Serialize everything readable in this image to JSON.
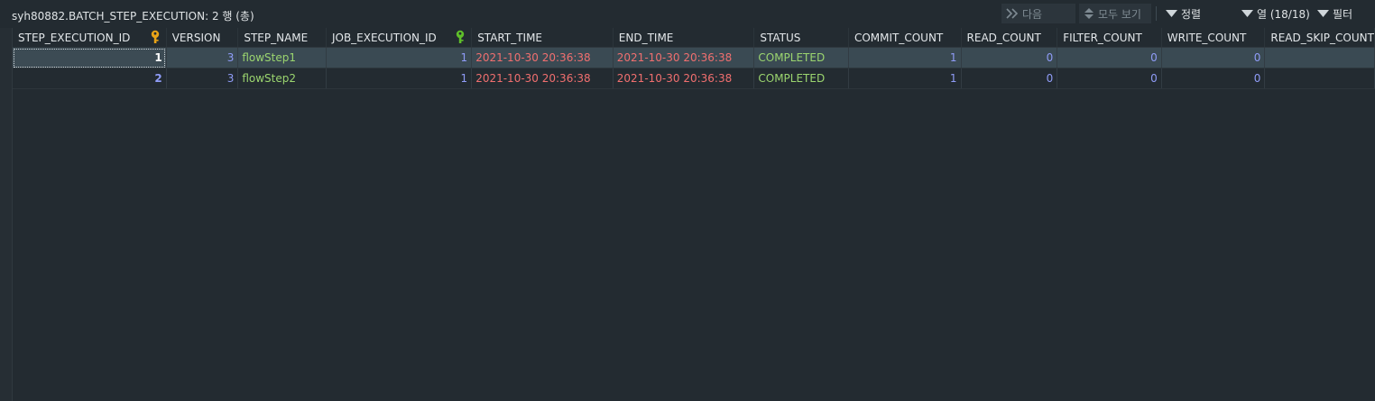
{
  "window": {
    "title": "syh80882.BATCH_STEP_EXECUTION: 2 행 (총)"
  },
  "toolbar": {
    "next_label": "다음",
    "show_all_label": "모두 보기",
    "sort_label": "정렬",
    "columns_label": "열 (18/18)",
    "filter_label": "필터"
  },
  "table": {
    "columns": [
      "STEP_EXECUTION_ID",
      "VERSION",
      "STEP_NAME",
      "JOB_EXECUTION_ID",
      "START_TIME",
      "END_TIME",
      "STATUS",
      "COMMIT_COUNT",
      "READ_COUNT",
      "FILTER_COUNT",
      "WRITE_COUNT",
      "READ_SKIP_COUNT"
    ],
    "rows": [
      [
        "1",
        "3",
        "flowStep1",
        "1",
        "2021-10-30 20:36:38",
        "2021-10-30 20:36:38",
        "COMPLETED",
        "1",
        "0",
        "0",
        "0",
        ""
      ],
      [
        "2",
        "3",
        "flowStep2",
        "1",
        "2021-10-30 20:36:38",
        "2021-10-30 20:36:38",
        "COMPLETED",
        "1",
        "0",
        "0",
        "0",
        ""
      ]
    ]
  },
  "colors": {
    "background": "#232b31",
    "selected_row": "#3a4a53",
    "number": "#8f9cf7",
    "string": "#9bd56f",
    "datetime": "#f06f6f",
    "primary_key_icon": "#e8a317",
    "foreign_key_icon": "#5fbf2a"
  },
  "icons": {
    "step_execution_id": "primary-key-icon",
    "job_execution_id": "foreign-key-icon"
  }
}
